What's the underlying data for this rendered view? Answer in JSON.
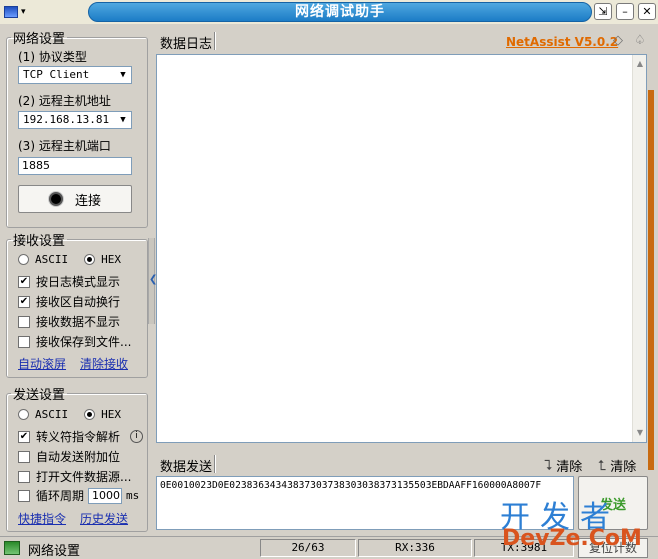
{
  "window": {
    "title": "网络调试助手",
    "sysmenu_arrow": "▾"
  },
  "network": {
    "group_title": "网络设置",
    "protocol_label": "(1) 协议类型",
    "protocol_value": "TCP Client",
    "host_label": "(2) 远程主机地址",
    "host_value": "192.168.13.81",
    "port_label": "(3) 远程主机端口",
    "port_value": "1885",
    "connect_label": "连接"
  },
  "receive": {
    "group_title": "接收设置",
    "mode_ascii": "ASCII",
    "mode_hex": "HEX",
    "selected_mode": "HEX",
    "opt_log_mode": "按日志模式显示",
    "opt_log_mode_checked": true,
    "opt_auto_wrap": "接收区自动换行",
    "opt_auto_wrap_checked": true,
    "opt_hide_data": "接收数据不显示",
    "opt_hide_data_checked": false,
    "opt_save_file": "接收保存到文件...",
    "opt_save_file_checked": false,
    "link_autoscroll": "自动滚屏",
    "link_clear": "清除接收"
  },
  "send": {
    "group_title": "发送设置",
    "mode_ascii": "ASCII",
    "mode_hex": "HEX",
    "selected_mode": "HEX",
    "opt_escape": "转义符指令解析",
    "opt_escape_checked": true,
    "opt_append_check": "自动发送附加位",
    "opt_append_check_checked": false,
    "opt_file_source": "打开文件数据源...",
    "opt_file_source_checked": false,
    "opt_loop": "循环周期",
    "opt_loop_checked": false,
    "loop_period": "1000",
    "loop_unit": "ms",
    "link_shortcuts": "快捷指令",
    "link_history": "历史发送"
  },
  "log": {
    "tab_label": "数据日志",
    "brand": "NetAssist V5.0.2"
  },
  "send_panel": {
    "tab_label": "数据发送",
    "clear_label_1": "清除",
    "clear_label_2": "清除",
    "payload": "0E0010023D0E02383634343837303738303038373135503EBDAAFF160000A8007F",
    "send_button": "发送"
  },
  "status": {
    "label": "网络设置",
    "progress": "26/63",
    "rx": "RX:336",
    "tx": "TX:3981",
    "reset": "复位计数"
  },
  "watermark": {
    "cn": "开发者",
    "en": "DevZe.CoM"
  },
  "colors": {
    "title_bar": "#1c7cc6",
    "brand": "#e06a00",
    "link": "#1a2fb0",
    "send_button_text": "#3a9a2a"
  }
}
